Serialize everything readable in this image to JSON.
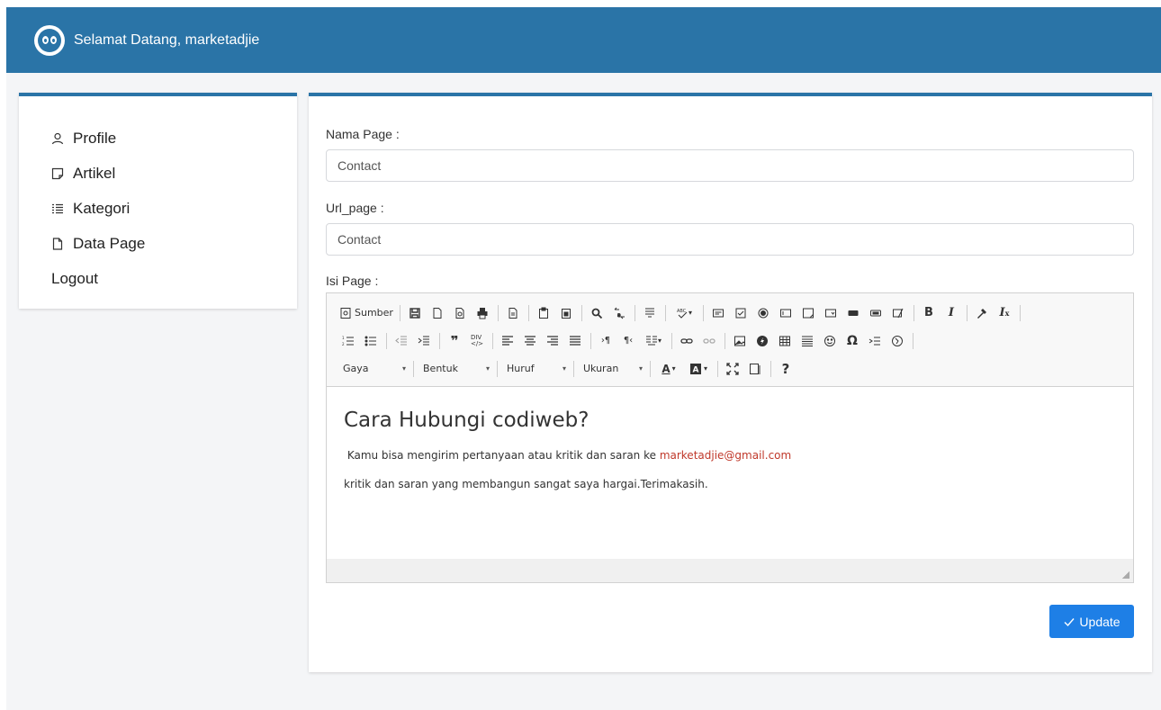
{
  "header": {
    "welcome": "Selamat Datang, marketadjie"
  },
  "sidebar": {
    "items": [
      {
        "label": "Profile",
        "icon": "user-icon"
      },
      {
        "label": "Artikel",
        "icon": "note-icon"
      },
      {
        "label": "Kategori",
        "icon": "list-icon"
      },
      {
        "label": "Data Page",
        "icon": "file-icon"
      },
      {
        "label": "Logout",
        "icon": ""
      }
    ]
  },
  "form": {
    "nama_label": "Nama Page :",
    "nama_value": "Contact",
    "url_label": "Url_page :",
    "url_value": "Contact",
    "isi_label": "Isi Page :"
  },
  "editor": {
    "source_label": "Sumber",
    "combos": {
      "style": "Gaya",
      "format": "Bentuk",
      "font": "Huruf",
      "size": "Ukuran"
    },
    "help": "?",
    "content": {
      "heading": "Cara Hubungi codiweb?",
      "line1_text": " Kamu bisa mengirim pertanyaan atau kritik dan saran ke ",
      "line1_link": "marketadjie@gmail.com",
      "line2": "kritik dan saran yang membangun sangat saya hargai.Terimakasih."
    }
  },
  "actions": {
    "update_label": "Update"
  },
  "colors": {
    "primary": "#2a74a7",
    "button": "#1e7fe6",
    "link": "#c0392b"
  }
}
